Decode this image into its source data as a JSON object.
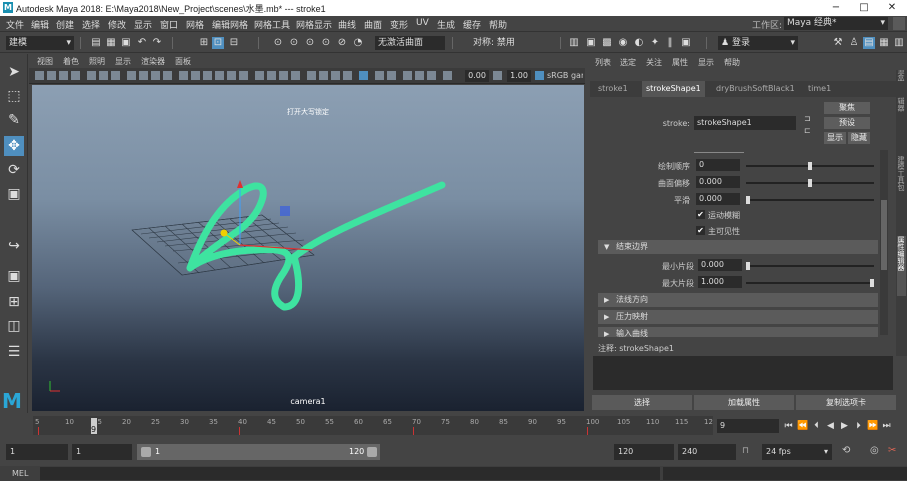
{
  "window": {
    "title": "Autodesk Maya 2018: E:\\Maya2018\\New_Project\\scenes\\水墨.mb*   ---   stroke1",
    "logo": "M",
    "minimize": "−",
    "maximize": "□",
    "close": "✕"
  },
  "menubar": {
    "items": [
      "文件",
      "编辑",
      "创建",
      "选择",
      "修改",
      "显示",
      "窗口",
      "网格",
      "编辑网格",
      "网格工具",
      "网格显示",
      "曲线",
      "曲面",
      "变形",
      "UV",
      "生成",
      "缓存",
      "帮助"
    ],
    "workspace_label": "工作区:",
    "workspace_value": "Maya 经典*"
  },
  "shelf": {
    "mode": "建模",
    "live_surface": "无激活曲面",
    "symmetry": "对称: 禁用",
    "login": "登录"
  },
  "viewport": {
    "menu": [
      "视图",
      "着色",
      "照明",
      "显示",
      "渲染器",
      "面板"
    ],
    "near": "0.00",
    "far": "1.00",
    "colorspace": "sRGB gamma",
    "hud_top": "打开大写锁定",
    "camera": "camera1",
    "stroke_color": "#3ee3a0"
  },
  "attribute_editor": {
    "menu": [
      "列表",
      "选定",
      "关注",
      "属性",
      "显示",
      "帮助"
    ],
    "tabs": [
      "stroke1",
      "strokeShape1",
      "dryBrushSoftBlack1",
      "time1"
    ],
    "stroke_label": "stroke:",
    "stroke_value": "strokeShape1",
    "focus_btn": "聚焦",
    "preset_btn": "预设",
    "show_btn": "显示",
    "hide_btn": "隐藏",
    "draw_order_label": "绘制顺序",
    "draw_order_value": "0",
    "surface_offset_label": "曲面偏移",
    "surface_offset_value": "0.000",
    "smooth_label": "平滑",
    "smooth_value": "0.000",
    "motion_blur_label": "运动模糊",
    "primary_vis_label": "主可见性",
    "motion_blur_checked": "✔",
    "primary_vis_checked": "✔",
    "sections": [
      "结束边界",
      "法线方向",
      "压力映射",
      "输入曲线"
    ],
    "min_clip_label": "最小片段",
    "min_clip_value": "0.000",
    "max_clip_label": "最大片段",
    "max_clip_value": "1.000",
    "notes_label": "注释: strokeShape1",
    "select_btn": "选择",
    "load_attrs_btn": "加载属性",
    "copy_tab_btn": "复制选项卡"
  },
  "timeline": {
    "ticks": [
      "5",
      "10",
      "15",
      "20",
      "25",
      "30",
      "35",
      "40",
      "45",
      "50",
      "55",
      "60",
      "65",
      "70",
      "75",
      "80",
      "85",
      "90",
      "95",
      "100",
      "105",
      "110",
      "115",
      "12"
    ],
    "current_frame": "9",
    "frame_field": "9"
  },
  "range": {
    "start_min": "1",
    "start": "1",
    "bar_start": "1",
    "bar_end": "120",
    "end": "120",
    "end_max": "240",
    "fps": "24 fps"
  },
  "cmdline": {
    "label": "MEL"
  },
  "side_tabs": [
    "通道盒/层编辑器",
    "建模工具包",
    "属性编辑器"
  ]
}
